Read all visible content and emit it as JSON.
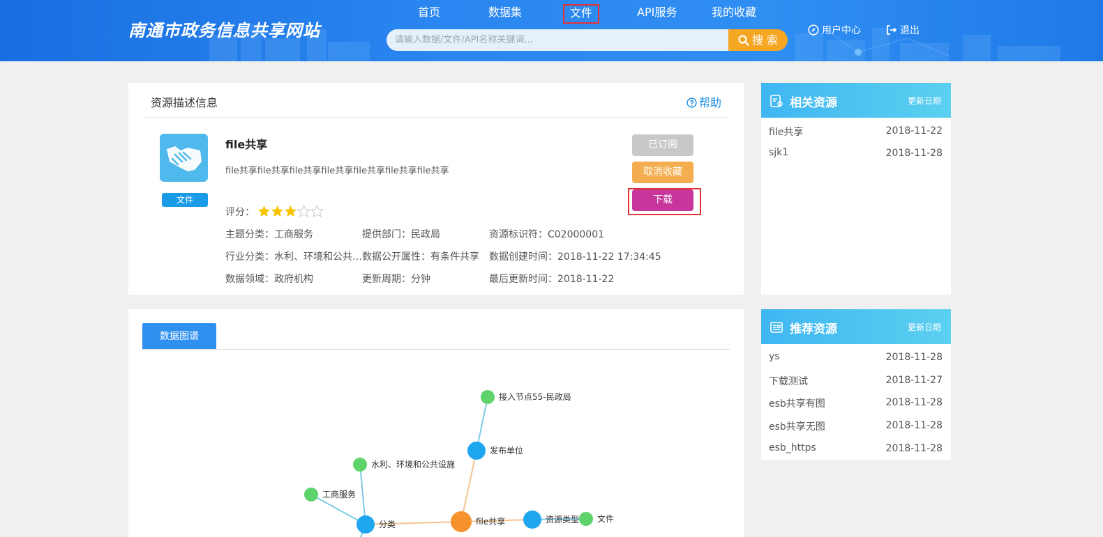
{
  "header": {
    "logo": "南通市政务信息共享网站",
    "nav": [
      {
        "label": "首页"
      },
      {
        "label": "数据集"
      },
      {
        "label": "文件"
      },
      {
        "label": "API服务"
      },
      {
        "label": "我的收藏"
      }
    ],
    "search_placeholder": "请输入数据/文件/API名称关键词...",
    "search_button": "搜 索",
    "user_center": "用户中心",
    "logout": "退出"
  },
  "resource": {
    "section_title": "资源描述信息",
    "help": "帮助",
    "type_tag": "文件",
    "name": "file共享",
    "description": "file共享file共享file共享file共享file共享file共享file共享",
    "rating_label": "评分：",
    "rating_stars": 3,
    "rating_max": 5,
    "meta": {
      "topic": "主题分类：工商服务",
      "provider": "提供部门：民政局",
      "resource_id": "资源标识符：C02000001",
      "industry": "行业分类：水利、环境和公共…",
      "open_attr": "数据公开属性：有条件共享",
      "created": "数据创建时间：2018-11-22 17:34:45",
      "domain": "数据领域：政府机构",
      "update_cycle": "更新周期：分钟",
      "last_updated": "最后更新时间：2018-11-22"
    },
    "buttons": {
      "subscribed": "已订阅",
      "unfavorite": "取消收藏",
      "download": "下载"
    }
  },
  "graph": {
    "tab": "数据图谱",
    "nodes": [
      {
        "label": "接入节点55-民政局"
      },
      {
        "label": "发布单位"
      },
      {
        "label": "水利、环境和公共设施"
      },
      {
        "label": "工商服务"
      },
      {
        "label": "分类"
      },
      {
        "label": "file共享"
      },
      {
        "label": "资源类型"
      },
      {
        "label": "文件"
      }
    ]
  },
  "related": {
    "title": "相关资源",
    "date_header": "更新日期",
    "items": [
      {
        "name": "file共享",
        "date": "2018-11-22"
      },
      {
        "name": "sjk1",
        "date": "2018-11-28"
      }
    ]
  },
  "recommended": {
    "title": "推荐资源",
    "date_header": "更新日期",
    "items": [
      {
        "name": "ys",
        "date": "2018-11-28"
      },
      {
        "name": "下载测试",
        "date": "2018-11-27"
      },
      {
        "name": "esb共享有图",
        "date": "2018-11-28"
      },
      {
        "name": "esb共享无图",
        "date": "2018-11-28"
      },
      {
        "name": "esb_https",
        "date": "2018-11-28"
      }
    ]
  },
  "colors": {
    "accent": "#2f90f0",
    "download": "#c8369c",
    "favorite": "#f4ae50",
    "node_green": "#5ed36a",
    "node_blue": "#1ea6ee",
    "node_orange": "#f7932e"
  }
}
